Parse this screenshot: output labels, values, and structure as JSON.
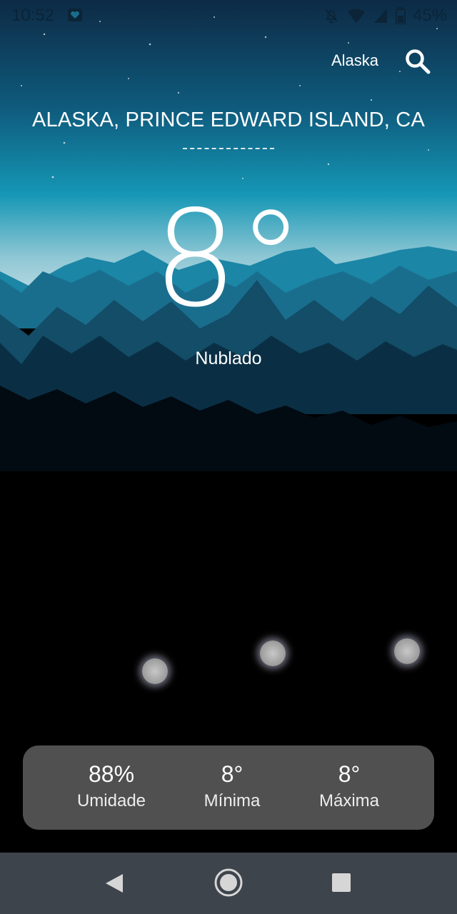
{
  "status_bar": {
    "time": "10:52",
    "battery": "45%",
    "left_icon": "heart-notification-icon",
    "right_icons": [
      "bell-off-icon",
      "wifi-icon",
      "cellular-signal-icon",
      "battery-icon"
    ]
  },
  "header": {
    "city_short": "Alaska",
    "search_icon": "search-icon"
  },
  "location": "ALASKA, PRINCE EDWARD ISLAND, CA",
  "weather": {
    "temperature": "8°",
    "condition": "Nublado"
  },
  "stats": [
    {
      "value": "88%",
      "label": "Umidade"
    },
    {
      "value": "8°",
      "label": "Mínima"
    },
    {
      "value": "8°",
      "label": "Máxima"
    }
  ],
  "nav": {
    "icons": [
      "back-icon",
      "home-icon",
      "recents-icon"
    ]
  },
  "colors": {
    "sky_top": "#0d2a45",
    "sky_mid": "#1597b5",
    "sky_horizon": "#cde3ea",
    "card_bg": "#505050",
    "nav_bg": "#3e444c",
    "text": "#ffffff"
  }
}
